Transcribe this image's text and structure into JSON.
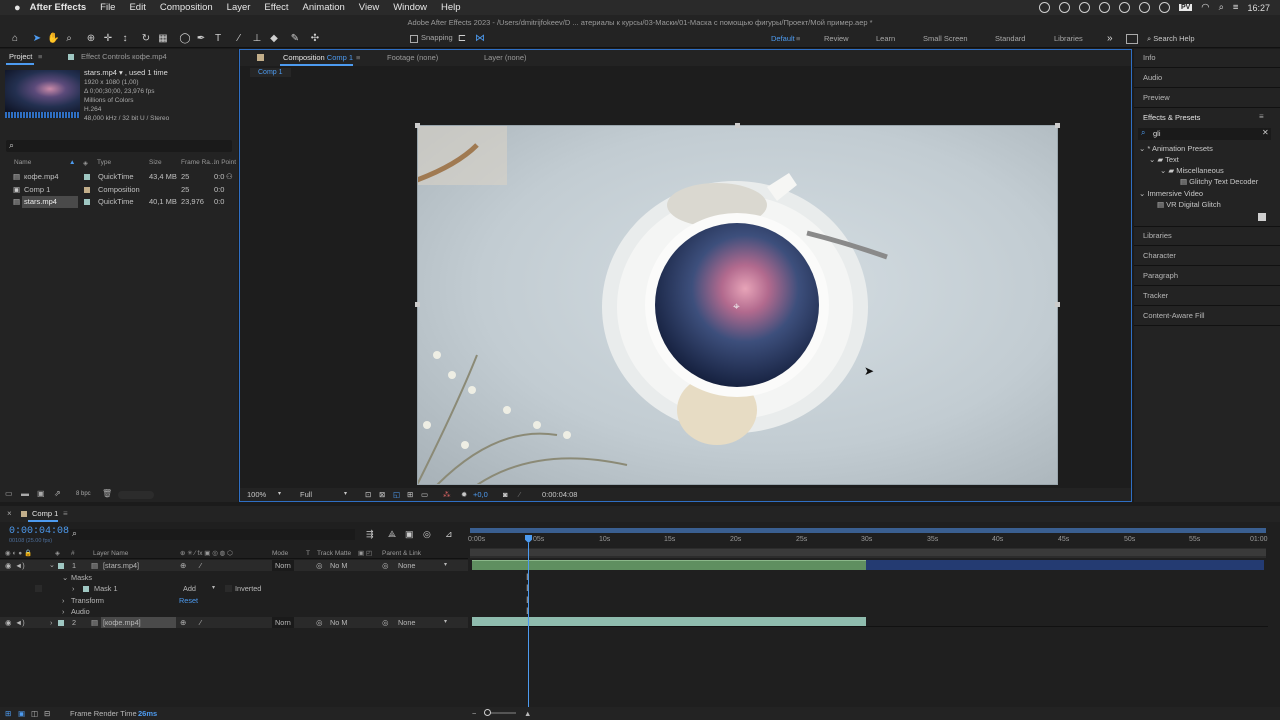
{
  "menubar": {
    "app": "After Effects",
    "items": [
      "File",
      "Edit",
      "Composition",
      "Layer",
      "Effect",
      "Animation",
      "View",
      "Window",
      "Help"
    ],
    "clock": "16:27",
    "pv_badge": "PV"
  },
  "titlebar": "Adobe After Effects 2023 - /Users/dmitrijfokeev/D ... атериалы к курсы/03-Маски/01-Маска с помощью фигуры/Проект/Мой пример.aep *",
  "toolbar": {
    "snapping": "Snapping",
    "workspaces": [
      "Default",
      "Review",
      "Learn",
      "Small Screen",
      "Standard",
      "Libraries"
    ],
    "active_workspace": "Default",
    "overflow": "»",
    "search_help": "Search Help"
  },
  "project": {
    "tab_project": "Project",
    "tab_effect_controls": "Effect Controls кофе.mp4",
    "info_name": "stars.mp4 ▾ , used 1 time",
    "info_lines": [
      "1920 x 1080 (1,00)",
      "Δ 0;00;30;00, 23,976 fps",
      "Millions of Colors",
      "H.264",
      "48,000 kHz / 32 bit U / Stereo"
    ],
    "search_placeholder": "",
    "columns": [
      "Name",
      "Type",
      "Size",
      "Frame Ra...",
      "In Point"
    ],
    "items": [
      {
        "name": "кофе.mp4",
        "type": "QuickTime",
        "size": "43,4 MB",
        "fps": "25",
        "in": "0:0",
        "color": "#9fc7c2"
      },
      {
        "name": "Comp 1",
        "type": "Composition",
        "size": "",
        "fps": "25",
        "in": "0:0",
        "color": "#c2ae8a"
      },
      {
        "name": "stars.mp4",
        "type": "QuickTime",
        "size": "40,1 MB",
        "fps": "23,976",
        "in": "0:0",
        "color": "#9fc7c2"
      }
    ],
    "bpc": "8 bpc"
  },
  "viewer": {
    "tab_comp_prefix": "Composition",
    "tab_comp_name": "Comp 1",
    "tab_footage": "Footage (none)",
    "tab_layer": "Layer (none)",
    "breadcrumb": "Comp 1",
    "zoom": "100%",
    "resolution": "Full",
    "exposure": "+0,0",
    "timecode": "0:00:04:08"
  },
  "right_panels": {
    "info": "Info",
    "audio": "Audio",
    "preview": "Preview",
    "effects_presets": "Effects & Presets",
    "search_value": "gli",
    "tree": [
      {
        "label": "* Animation Presets",
        "level": 0
      },
      {
        "label": "Text",
        "level": 1
      },
      {
        "label": "Miscellaneous",
        "level": 2
      },
      {
        "label": "Glitchy Text Decoder",
        "level": 3
      },
      {
        "label": "Immersive Video",
        "level": 0
      },
      {
        "label": "VR Digital Glitch",
        "level": 1
      }
    ],
    "libraries": "Libraries",
    "character": "Character",
    "paragraph": "Paragraph",
    "tracker": "Tracker",
    "content_aware": "Content-Aware Fill"
  },
  "timeline": {
    "tab": "Comp 1",
    "timecode": "0:00:04:08",
    "frames": "00108 (25.00 fps)",
    "headers": {
      "num": "#",
      "layer_name": "Layer Name",
      "mode": "Mode",
      "t": "T",
      "track_matte": "Track Matte",
      "parent": "Parent & Link"
    },
    "layers": [
      {
        "num": "1",
        "name": "[stars.mp4]",
        "mode": "Norn",
        "matte": "No M",
        "parent": "None"
      },
      {
        "num": "2",
        "name": "[кофе.mp4]",
        "mode": "Norn",
        "matte": "No M",
        "parent": "None"
      }
    ],
    "masks": "Masks",
    "mask1": "Mask 1",
    "mask_mode": "Add",
    "inverted": "Inverted",
    "transform": "Transform",
    "reset": "Reset",
    "audio": "Audio",
    "ruler": [
      "0:00s",
      "05s",
      "10s",
      "15s",
      "20s",
      "25s",
      "30s",
      "35s",
      "40s",
      "45s",
      "50s",
      "55s",
      "01:00"
    ],
    "frame_render_label": "Frame Render Time",
    "frame_render_value": "26ms"
  }
}
